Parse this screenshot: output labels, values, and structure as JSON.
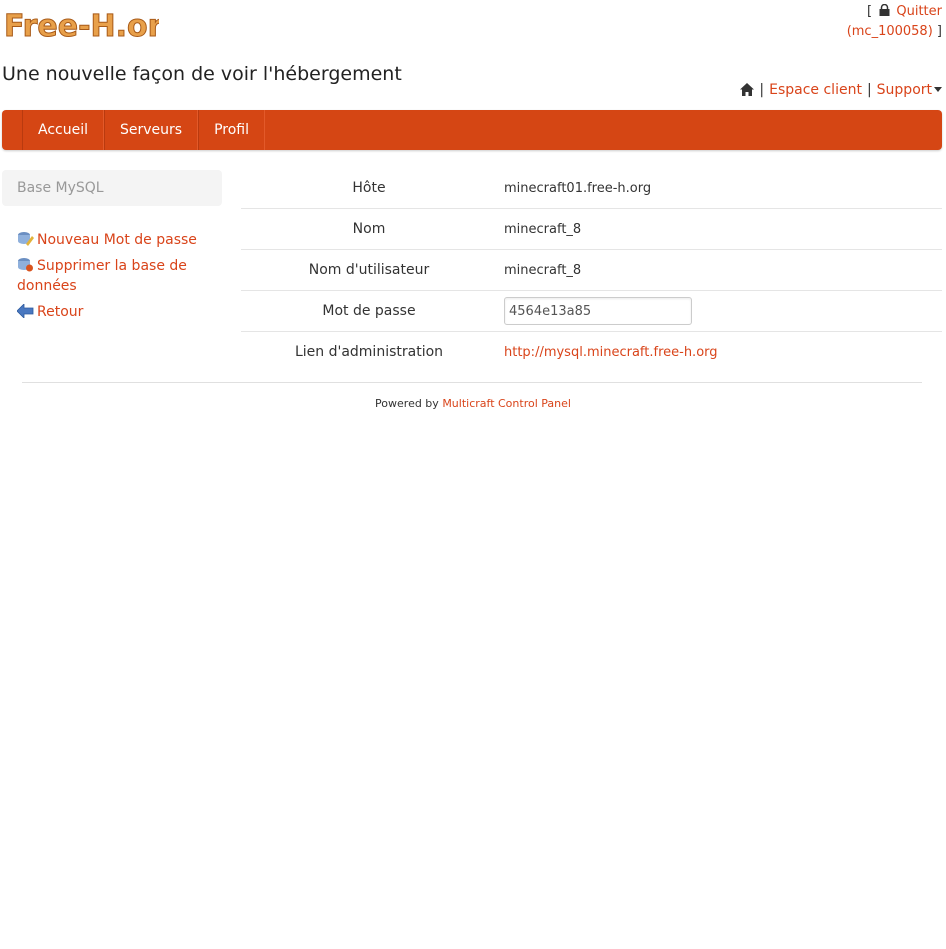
{
  "brand": {
    "logo_text": "Free-H.org",
    "accent": "#d54614",
    "logo_color": "#e07a2c"
  },
  "account": {
    "bracket_open": "[",
    "logout_label": "Quitter",
    "username": "(mc_100058)",
    "bracket_close": "]"
  },
  "tagline": "Une nouvelle façon de voir l'hébergement",
  "toplinks": {
    "separator": "|",
    "client_space": "Espace client",
    "support": "Support"
  },
  "nav": {
    "items": [
      "Accueil",
      "Serveurs",
      "Profil"
    ]
  },
  "sidebar": {
    "header": "Base MySQL",
    "links": {
      "new_password": "Nouveau Mot de passe",
      "delete_db": "Supprimer la base de données",
      "back": "Retour"
    }
  },
  "details": {
    "host_label": "Hôte",
    "host_value": "minecraft01.free-h.org",
    "name_label": "Nom",
    "name_value": "minecraft_8",
    "user_label": "Nom d'utilisateur",
    "user_value": "minecraft_8",
    "password_label": "Mot de passe",
    "password_value": "4564e13a85",
    "admin_label": "Lien d'administration",
    "admin_value": "http://mysql.minecraft.free-h.org"
  },
  "footer": {
    "powered_by": "Powered by",
    "product": "Multicraft Control Panel"
  }
}
